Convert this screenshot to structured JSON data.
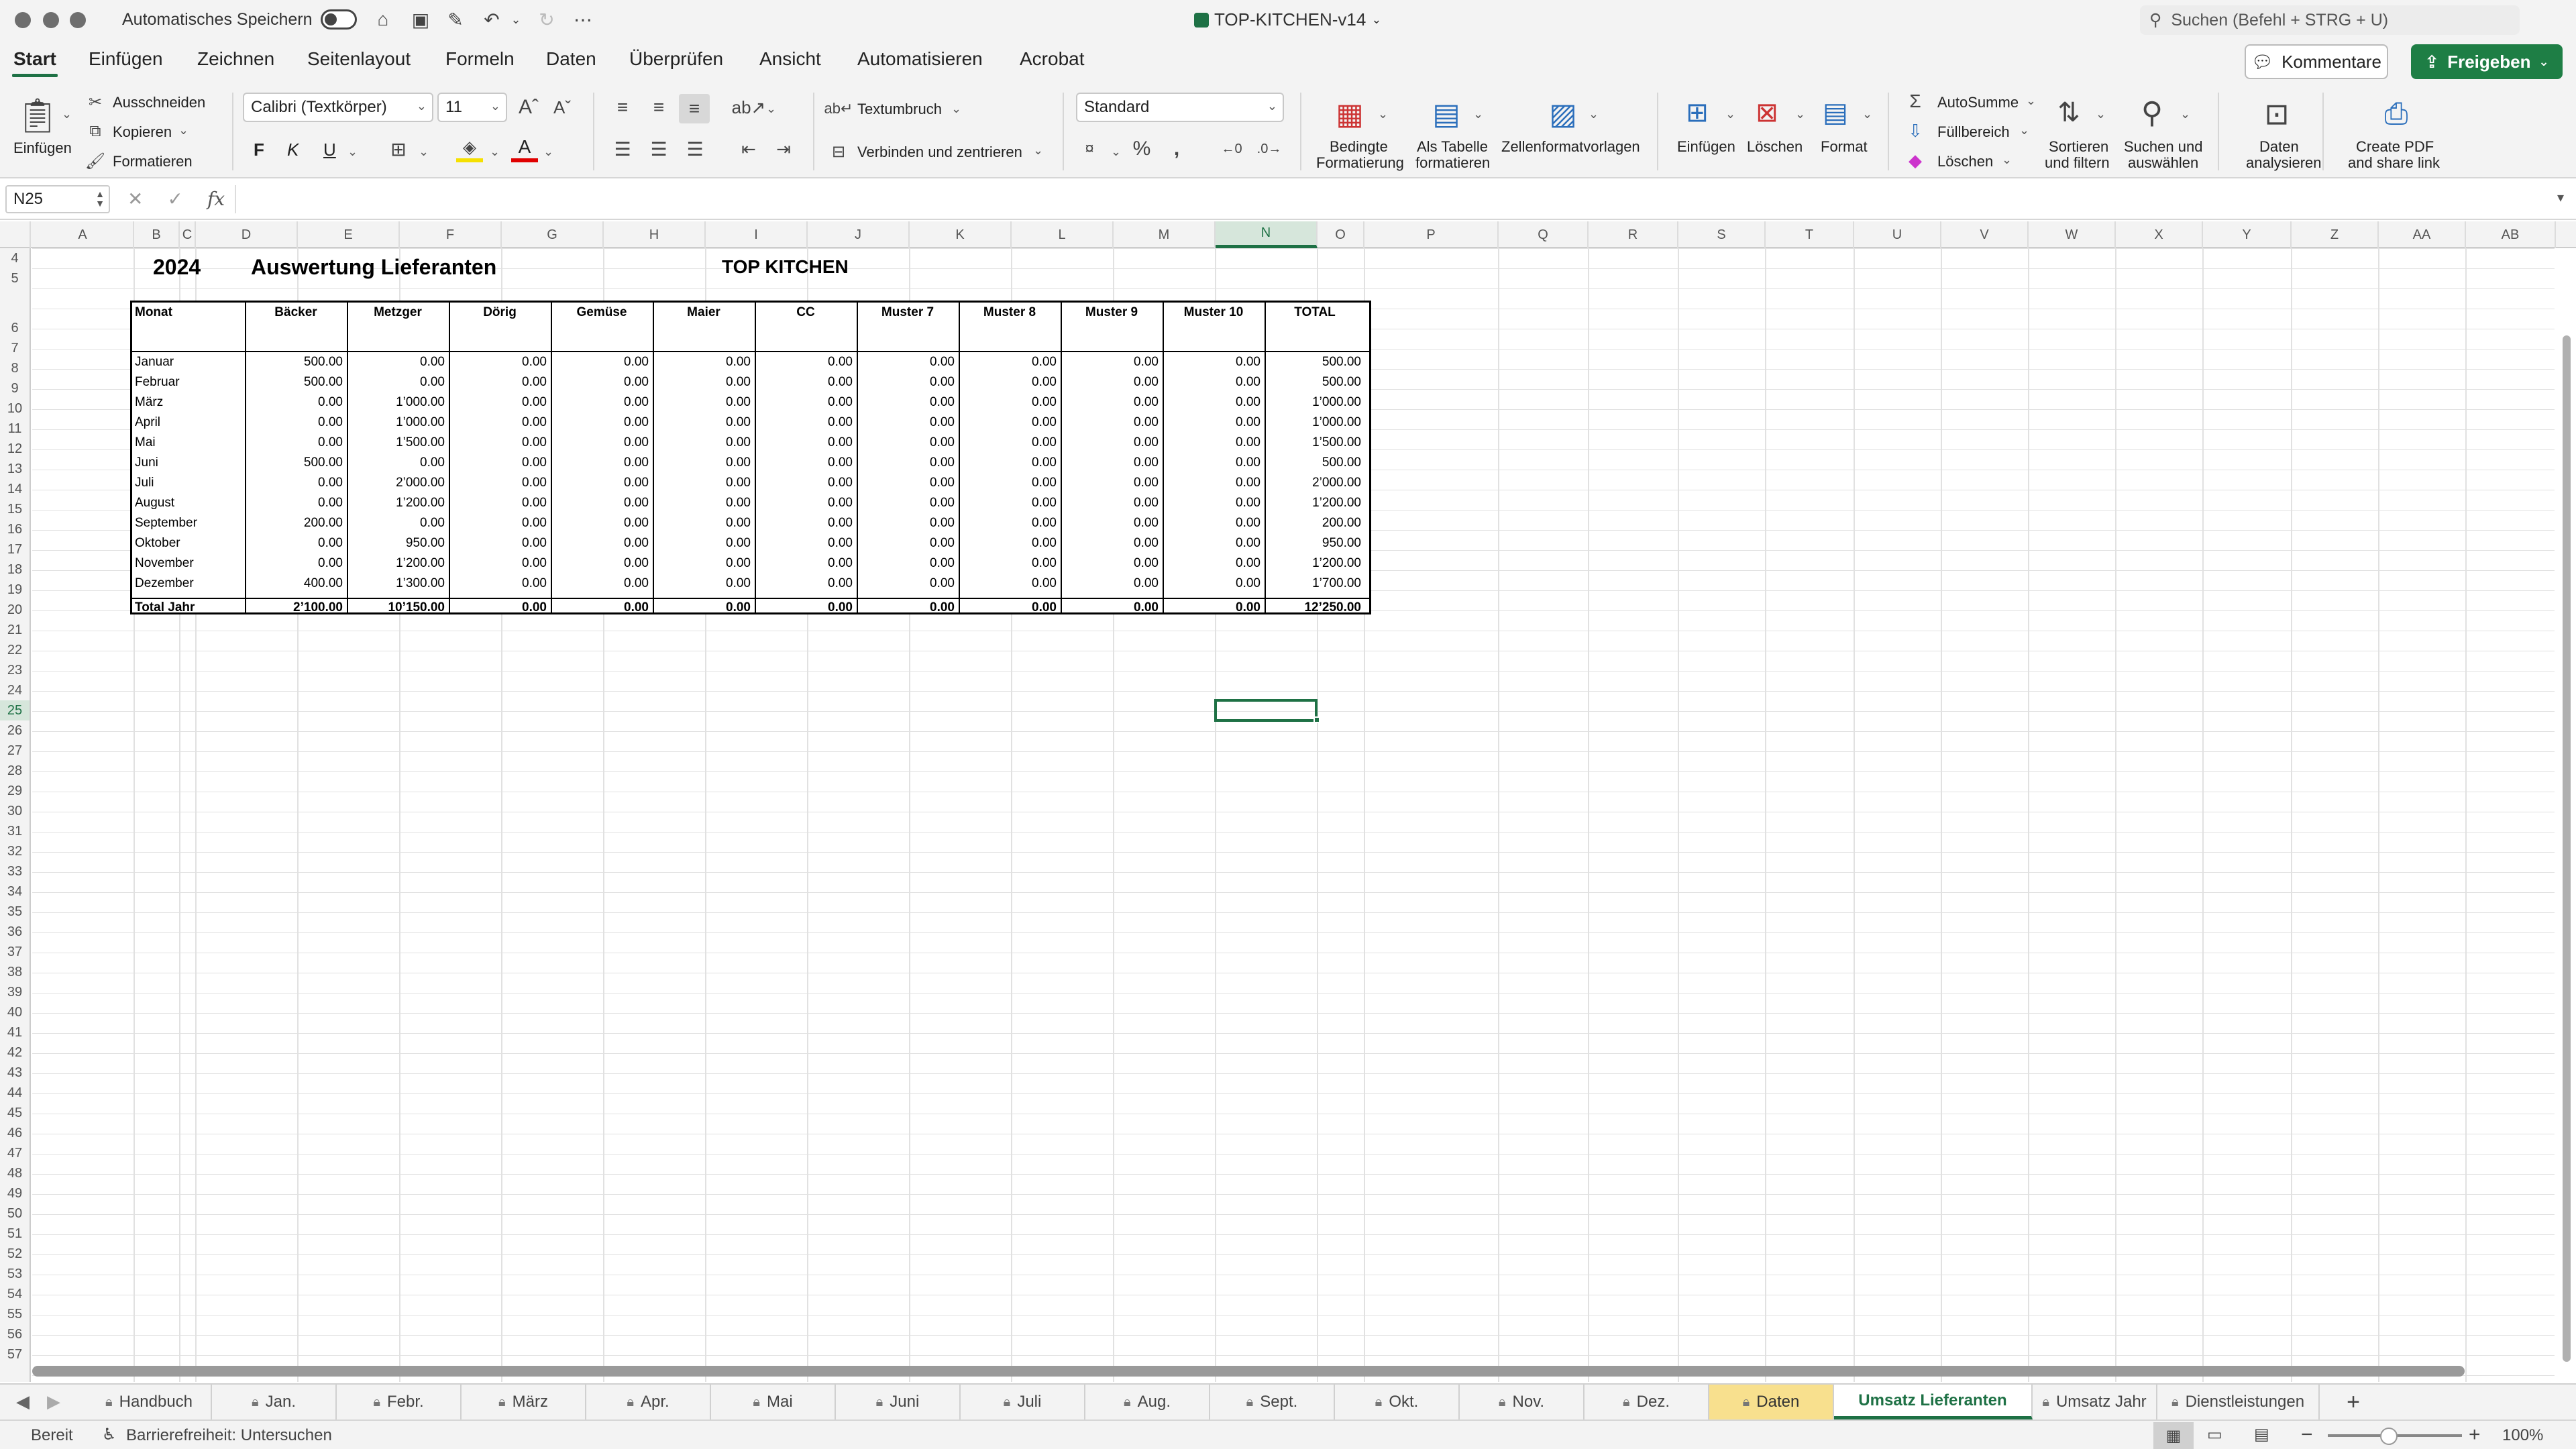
{
  "titlebar": {
    "autosave_label": "Automatisches Speichern",
    "doc_title": "TOP-KITCHEN-v14",
    "search_placeholder": "Suchen (Befehl + STRG + U)"
  },
  "ribbon_tabs": [
    "Start",
    "Einfügen",
    "Zeichnen",
    "Seitenlayout",
    "Formeln",
    "Daten",
    "Überprüfen",
    "Ansicht",
    "Automatisieren",
    "Acrobat"
  ],
  "actions": {
    "comments": "Kommentare",
    "share": "Freigeben"
  },
  "ribbon": {
    "paste": "Einfügen",
    "cut": "Ausschneiden",
    "copy": "Kopieren",
    "format_painter": "Formatieren",
    "font_name": "Calibri (Textkörper)",
    "font_size": "11",
    "bold": "F",
    "italic": "K",
    "underline": "U",
    "wrap": "Textumbruch",
    "merge": "Verbinden und zentrieren",
    "number_format": "Standard",
    "cond_format_1": "Bedingte",
    "cond_format_2": "Formatierung",
    "as_table_1": "Als Tabelle",
    "as_table_2": "formatieren",
    "cell_styles": "Zellenformatvorlagen",
    "insert": "Einfügen",
    "delete": "Löschen",
    "format": "Format",
    "autosum": "AutoSumme",
    "fill": "Füllbereich",
    "clear": "Löschen",
    "sort_1": "Sortieren",
    "sort_2": "und filtern",
    "find_1": "Suchen und",
    "find_2": "auswählen",
    "analyze_1": "Daten",
    "analyze_2": "analysieren",
    "pdf_1": "Create PDF",
    "pdf_2": "and share link"
  },
  "formula_bar": {
    "name_box": "N25",
    "fx": "fx",
    "formula": ""
  },
  "columns": [
    "A",
    "B",
    "C",
    "D",
    "E",
    "F",
    "G",
    "H",
    "I",
    "J",
    "K",
    "L",
    "M",
    "N",
    "O",
    "P",
    "Q",
    "R",
    "S",
    "T",
    "U",
    "V",
    "W",
    "X",
    "Y",
    "Z",
    "AA",
    "AB"
  ],
  "selected_col": "N",
  "selected_row": "25",
  "sheet": {
    "year": "2024",
    "title": "Auswertung Lieferanten",
    "company": "TOP KITCHEN",
    "headers": [
      "Monat",
      "Bäcker",
      "Metzger",
      "Dörig",
      "Gemüse",
      "Maier",
      "CC",
      "Muster 7",
      "Muster 8",
      "Muster 9",
      "Muster 10",
      "TOTAL"
    ],
    "rows": [
      [
        "Januar",
        "500.00",
        "0.00",
        "0.00",
        "0.00",
        "0.00",
        "0.00",
        "0.00",
        "0.00",
        "0.00",
        "0.00",
        "500.00"
      ],
      [
        "Februar",
        "500.00",
        "0.00",
        "0.00",
        "0.00",
        "0.00",
        "0.00",
        "0.00",
        "0.00",
        "0.00",
        "0.00",
        "500.00"
      ],
      [
        "März",
        "0.00",
        "1’000.00",
        "0.00",
        "0.00",
        "0.00",
        "0.00",
        "0.00",
        "0.00",
        "0.00",
        "0.00",
        "1’000.00"
      ],
      [
        "April",
        "0.00",
        "1’000.00",
        "0.00",
        "0.00",
        "0.00",
        "0.00",
        "0.00",
        "0.00",
        "0.00",
        "0.00",
        "1’000.00"
      ],
      [
        "Mai",
        "0.00",
        "1’500.00",
        "0.00",
        "0.00",
        "0.00",
        "0.00",
        "0.00",
        "0.00",
        "0.00",
        "0.00",
        "1’500.00"
      ],
      [
        "Juni",
        "500.00",
        "0.00",
        "0.00",
        "0.00",
        "0.00",
        "0.00",
        "0.00",
        "0.00",
        "0.00",
        "0.00",
        "500.00"
      ],
      [
        "Juli",
        "0.00",
        "2’000.00",
        "0.00",
        "0.00",
        "0.00",
        "0.00",
        "0.00",
        "0.00",
        "0.00",
        "0.00",
        "2’000.00"
      ],
      [
        "August",
        "0.00",
        "1’200.00",
        "0.00",
        "0.00",
        "0.00",
        "0.00",
        "0.00",
        "0.00",
        "0.00",
        "0.00",
        "1’200.00"
      ],
      [
        "September",
        "200.00",
        "0.00",
        "0.00",
        "0.00",
        "0.00",
        "0.00",
        "0.00",
        "0.00",
        "0.00",
        "0.00",
        "200.00"
      ],
      [
        "Oktober",
        "0.00",
        "950.00",
        "0.00",
        "0.00",
        "0.00",
        "0.00",
        "0.00",
        "0.00",
        "0.00",
        "0.00",
        "950.00"
      ],
      [
        "November",
        "0.00",
        "1’200.00",
        "0.00",
        "0.00",
        "0.00",
        "0.00",
        "0.00",
        "0.00",
        "0.00",
        "0.00",
        "1’200.00"
      ],
      [
        "Dezember",
        "400.00",
        "1’300.00",
        "0.00",
        "0.00",
        "0.00",
        "0.00",
        "0.00",
        "0.00",
        "0.00",
        "0.00",
        "1’700.00"
      ]
    ],
    "total_row": [
      "Total Jahr",
      "2’100.00",
      "10’150.00",
      "0.00",
      "0.00",
      "0.00",
      "0.00",
      "0.00",
      "0.00",
      "0.00",
      "0.00",
      "12’250.00"
    ]
  },
  "sheet_tabs": [
    {
      "label": "Handbuch",
      "locked": true,
      "style": "normal"
    },
    {
      "label": "Jan.",
      "locked": true,
      "style": "normal"
    },
    {
      "label": "Febr.",
      "locked": true,
      "style": "normal"
    },
    {
      "label": "März",
      "locked": true,
      "style": "normal"
    },
    {
      "label": "Apr.",
      "locked": true,
      "style": "normal"
    },
    {
      "label": "Mai",
      "locked": true,
      "style": "normal"
    },
    {
      "label": "Juni",
      "locked": true,
      "style": "normal"
    },
    {
      "label": "Juli",
      "locked": true,
      "style": "normal"
    },
    {
      "label": "Aug.",
      "locked": true,
      "style": "normal"
    },
    {
      "label": "Sept.",
      "locked": true,
      "style": "normal"
    },
    {
      "label": "Okt.",
      "locked": true,
      "style": "normal"
    },
    {
      "label": "Nov.",
      "locked": true,
      "style": "normal"
    },
    {
      "label": "Dez.",
      "locked": true,
      "style": "normal"
    },
    {
      "label": "Daten",
      "locked": true,
      "style": "yellow"
    },
    {
      "label": "Umsatz Lieferanten",
      "locked": false,
      "style": "active"
    },
    {
      "label": "Umsatz Jahr",
      "locked": true,
      "style": "normal"
    },
    {
      "label": "Dienstleistungen",
      "locked": true,
      "style": "normal"
    }
  ],
  "add_sheet": "+",
  "status": {
    "ready": "Bereit",
    "accessibility": "Barrierefreiheit: Untersuchen",
    "zoom": "100%"
  },
  "icons": [
    "home-icon",
    "save-icon",
    "undo-icon",
    "redo-icon",
    "search-icon",
    "comment-icon",
    "share-icon",
    "lock-icon",
    "paste-icon",
    "scissors-icon",
    "copy-icon",
    "brush-icon"
  ],
  "colors": {
    "accent": "#1e7145",
    "daten_tab": "#f8e08e"
  }
}
